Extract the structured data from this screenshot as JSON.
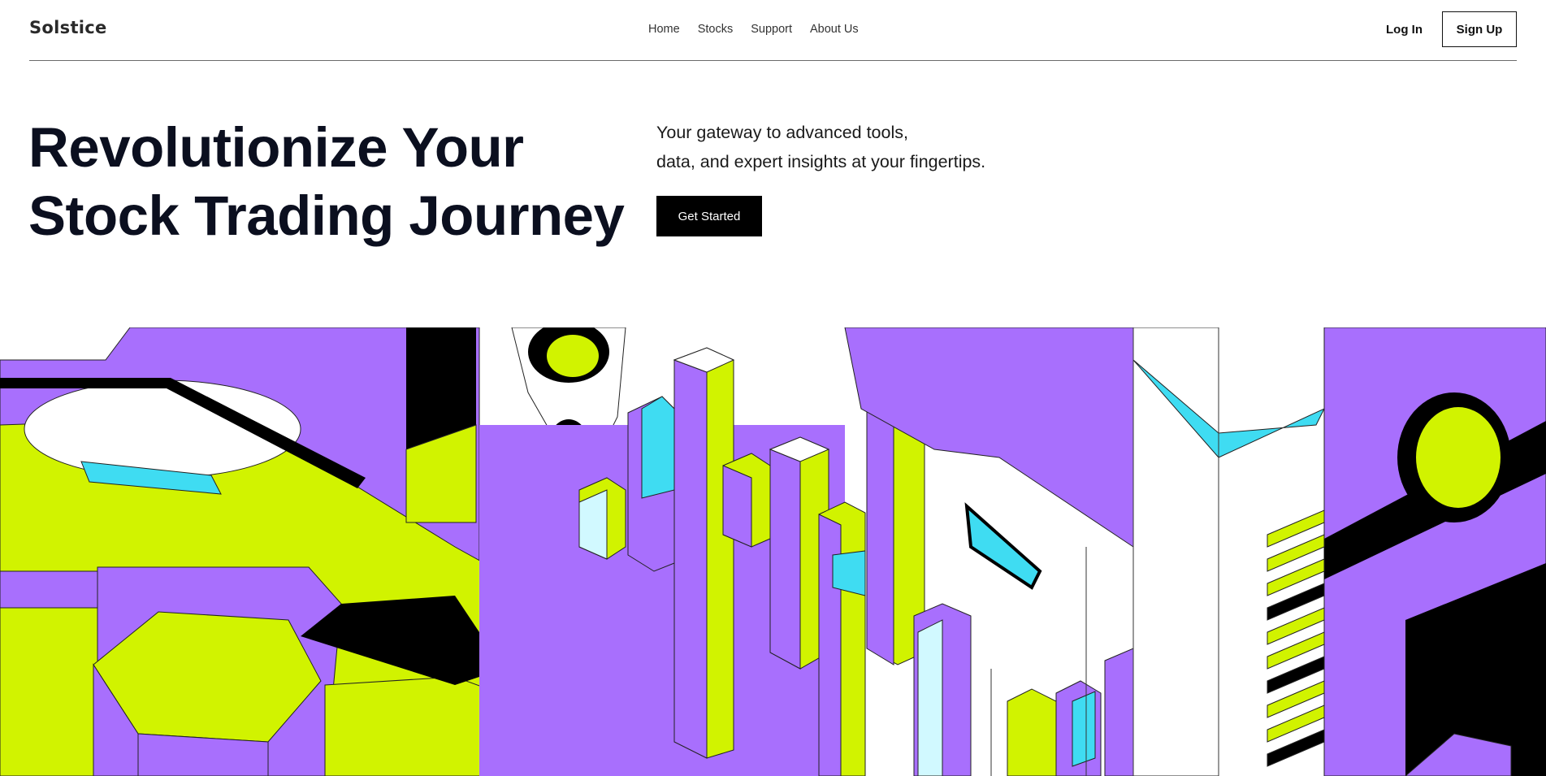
{
  "brand": "Solstice",
  "nav": {
    "links": [
      "Home",
      "Stocks",
      "Support",
      "About Us"
    ],
    "login": "Log In",
    "signup": "Sign Up"
  },
  "hero": {
    "title_line1": "Revolutionize Your",
    "title_line2": "Stock Trading Journey",
    "subtitle_line1": "Your gateway to advanced tools,",
    "subtitle_line2": "data, and expert insights at your fingertips.",
    "cta": "Get Started"
  },
  "colors": {
    "purple": "#a86ffd",
    "lime": "#d1f300",
    "cyan": "#3fdcf2",
    "black": "#000000",
    "navy_text": "#0b0f1f"
  }
}
